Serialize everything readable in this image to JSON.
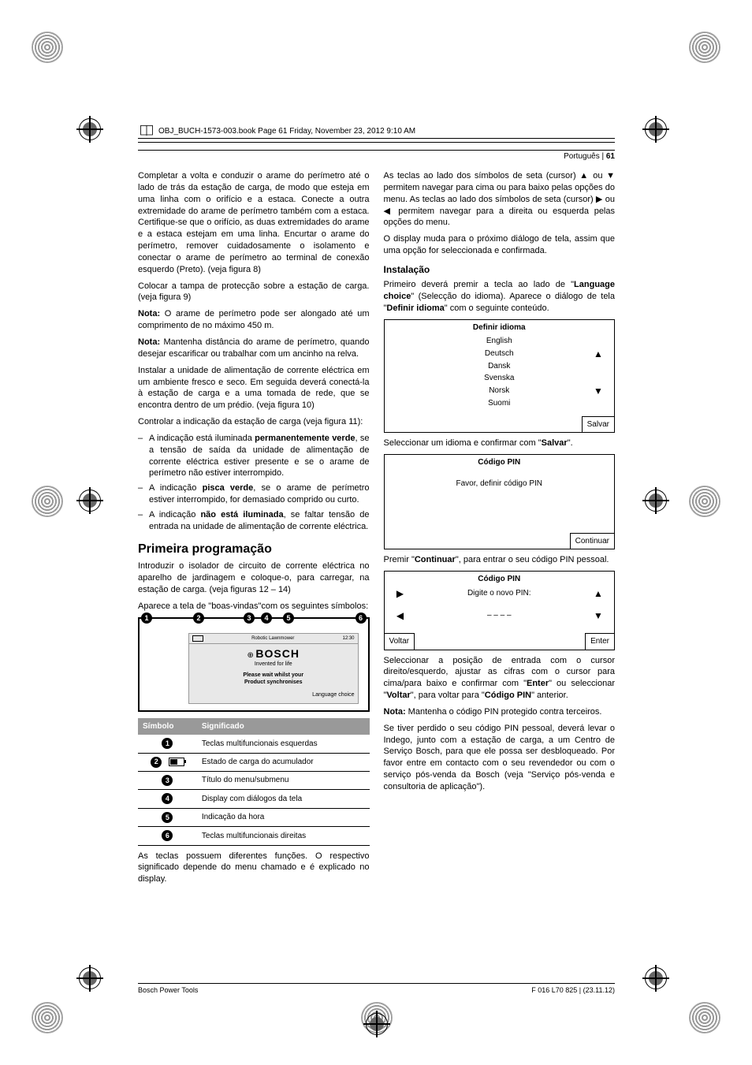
{
  "meta": {
    "book_header": "OBJ_BUCH-1573-003.book  Page 61  Friday, November 23, 2012  9:10 AM"
  },
  "header": {
    "lang": "Português",
    "page": "61"
  },
  "left_col": {
    "p1": "Completar a volta e conduzir o arame do perímetro até o lado de trás da estação de carga, de modo que esteja em uma linha com o orifício e a estaca. Conecte a outra extremidade do arame de perímetro também com a estaca. Certifique-se que o orifício, as duas extremidades do arame e a estaca estejam em uma linha. Encurtar o arame do perímetro, remover cuidadosamente o isolamento e conectar o arame de perímetro ao terminal de conexão esquerdo (Preto). (veja figura 8)",
    "p2": "Colocar a tampa de protecção sobre a estação de carga. (veja figura 9)",
    "p3a": "Nota:",
    "p3b": " O arame de perímetro pode ser alongado até um comprimento de no máximo 450 m.",
    "p4a": "Nota:",
    "p4b": " Mantenha distância do arame de perímetro, quando desejar escarificar ou trabalhar com um ancinho na relva.",
    "p5": "Instalar a unidade de alimentação de corrente eléctrica em um ambiente fresco e seco. Em seguida deverá conectá-la à estação de carga e a uma tomada de rede, que se encontra dentro de um prédio. (veja figura 10)",
    "p6": "Controlar a indicação da estação de carga (veja figura 11):",
    "li1a": "A indicação está iluminada ",
    "li1b": "permanentemente verde",
    "li1c": ", se a tensão de saída da unidade de alimentação de corrente eléctrica estiver presente e se o arame de perímetro não estiver interrompido.",
    "li2a": "A indicação ",
    "li2b": "pisca verde",
    "li2c": ", se o arame de perímetro estiver interrompido, for demasiado comprido ou curto.",
    "li3a": "A indicação ",
    "li3b": "não está iluminada",
    "li3c": ", se faltar tensão de entrada na unidade de alimentação de corrente eléctrica.",
    "h_prog": "Primeira programação",
    "p7": "Introduzir o isolador de circuito de corrente eléctrica no aparelho de jardinagem e coloque-o, para carregar, na estação de carga. (veja figuras 12 – 14)",
    "p8": "Aparece a tela de \"boas-vindas\"com os seguintes símbolos:",
    "disp": {
      "robotic": "Robotic Lawnmower",
      "time": "12:30",
      "brand": "BOSCH",
      "tag": "Invented for life",
      "msg1": "Please wait whilst your",
      "msg2": "Product synchronises",
      "lang": "Language choice"
    },
    "table": {
      "h1": "Símbolo",
      "h2": "Significado",
      "r1": "Teclas multifuncionais esquerdas",
      "r2": "Estado de carga do acumulador",
      "r3": "Título do menu/submenu",
      "r4": "Display com diálogos da tela",
      "r5": "Indicação da hora",
      "r6": "Teclas multifuncionais direitas"
    },
    "p9": "As teclas possuem diferentes funções. O respectivo significado depende do menu chamado e é explicado no display."
  },
  "right_col": {
    "p1": "As teclas ao lado dos símbolos de seta (cursor) ▲ ou ▼ permitem navegar para cima ou para baixo pelas opções do menu. As teclas ao lado dos símbolos de seta (cursor) ▶ ou ◀ permitem navegar para a direita ou esquerda pelas opções do menu.",
    "p2": "O display muda para o próximo diálogo de tela, assim que uma opção for seleccionada e confirmada.",
    "h_inst": "Instalação",
    "p3a": "Primeiro deverá premir a tecla ao lado de \"",
    "p3b": "Language choice",
    "p3c": "\" (Selecção do idioma). Aparece o diálogo de tela \"",
    "p3d": "Definir idioma",
    "p3e": "\" com o seguinte conteúdo.",
    "lang_box": {
      "title": "Definir idioma",
      "o1": "English",
      "o2": "Deutsch",
      "o3": "Dansk",
      "o4": "Svenska",
      "o5": "Norsk",
      "o6": "Suomi",
      "btn": "Salvar"
    },
    "p4a": "Seleccionar um idioma e confirmar com \"",
    "p4b": "Salvar",
    "p4c": "\".",
    "pin1": {
      "title": "Código PIN",
      "msg": "Favor, definir código PIN",
      "btn": "Continuar"
    },
    "p5a": "Premir \"",
    "p5b": "Continuar",
    "p5c": "\", para entrar o seu código PIN pessoal.",
    "pin2": {
      "title": "Código PIN",
      "msg": "Digite o novo PIN:",
      "dashes": "– – – –",
      "btn_l": "Voltar",
      "btn_r": "Enter"
    },
    "p6a": "Seleccionar a posição de entrada com o cursor direito/esquerdo, ajustar as cifras com o cursor para cima/para baixo e confirmar com \"",
    "p6b": "Enter",
    "p6c": "\" ou seleccionar \"",
    "p6d": "Voltar",
    "p6e": "\", para voltar para \"",
    "p6f": "Código PIN",
    "p6g": "\" anterior.",
    "p7a": "Nota:",
    "p7b": " Mantenha o código PIN protegido contra terceiros.",
    "p8": "Se tiver perdido o seu código PIN pessoal, deverá levar o Indego, junto com a estação de carga, a um Centro de Serviço Bosch, para que ele possa ser desbloqueado. Por favor entre em contacto com o seu revendedor ou com o serviço pós-venda da Bosch (veja \"Serviço pós-venda e consultoria de aplicação\")."
  },
  "footer": {
    "left": "Bosch Power Tools",
    "right": "F 016 L70 825 | (23.11.12)"
  }
}
